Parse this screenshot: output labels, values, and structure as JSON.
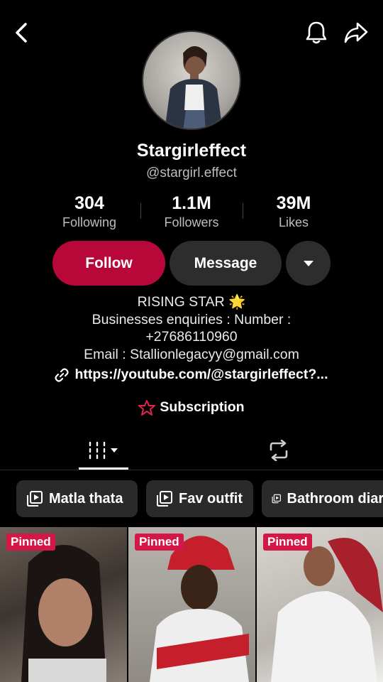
{
  "header": {
    "back_icon": "chevron-left-icon",
    "bell_icon": "bell-icon",
    "share_icon": "share-arrow-icon"
  },
  "profile": {
    "display_name": "Stargirleffect",
    "handle": "@stargirl.effect"
  },
  "stats": [
    {
      "value": "304",
      "label": "Following"
    },
    {
      "value": "1.1M",
      "label": "Followers"
    },
    {
      "value": "39M",
      "label": "Likes"
    }
  ],
  "actions": {
    "follow_label": "Follow",
    "message_label": "Message",
    "more_icon": "caret-down-icon"
  },
  "bio": {
    "line1": "RISING STAR 🌟",
    "line2": "Businesses enquiries : Number :",
    "line3": "+27686110960",
    "line4": "Email : Stallionlegacyy@gmail.com"
  },
  "link": {
    "text": "https://youtube.com/@stargirleffect?...",
    "icon": "link-icon"
  },
  "subscription": {
    "label": "Subscription",
    "icon": "star-badge-icon"
  },
  "tabs": {
    "videos_icon": "grid-bars-icon",
    "reposts_icon": "repost-icon"
  },
  "playlists": [
    {
      "label": "Matla thata"
    },
    {
      "label": "Fav outfit"
    },
    {
      "label": "Bathroom diaries"
    }
  ],
  "videos": [
    {
      "badge": "Pinned"
    },
    {
      "badge": "Pinned"
    },
    {
      "badge": "Pinned"
    }
  ],
  "colors": {
    "follow_button": "#b8083a",
    "pinned_badge": "#d31848",
    "secondary_button": "#2d2d2d"
  }
}
